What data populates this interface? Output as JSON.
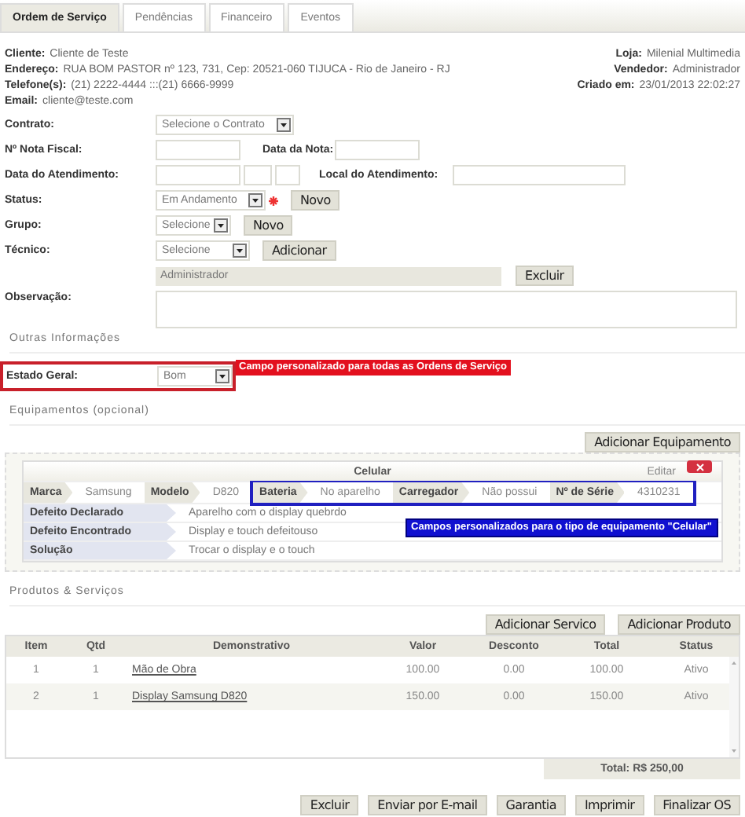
{
  "tabs": [
    {
      "label": "Ordem de Serviço",
      "selected": true
    },
    {
      "label": "Pendências",
      "selected": false
    },
    {
      "label": "Financeiro",
      "selected": false
    },
    {
      "label": "Eventos",
      "selected": false
    }
  ],
  "client_info": {
    "left": [
      {
        "label": "Cliente:",
        "value": "Cliente de Teste"
      },
      {
        "label": "Endereço:",
        "value": "RUA BOM PASTOR nº 123, 731, Cep: 20521-060 TIJUCA - Rio de Janeiro - RJ"
      },
      {
        "label": "Telefone(s):",
        "value": "(21) 2222-4444 :::(21) 6666-9999"
      },
      {
        "label": "Email:",
        "value": "cliente@teste.com"
      }
    ],
    "right": [
      {
        "label": "Loja:",
        "value": "Milenial Multimedia"
      },
      {
        "label": "Vendedor:",
        "value": "Administrador"
      },
      {
        "label": "Criado em:",
        "value": "23/01/2013 22:02:27"
      }
    ]
  },
  "form": {
    "contrato": {
      "label": "Contrato:",
      "placeholder": "Selecione o Contrato"
    },
    "nota_fiscal": {
      "label": "Nº Nota Fiscal:"
    },
    "data_nota": {
      "label": "Data da Nota:"
    },
    "data_atendimento": {
      "label": "Data do Atendimento:"
    },
    "local_atendimento": {
      "label": "Local do Atendimento:"
    },
    "status": {
      "label": "Status:",
      "value": "Em Andamento",
      "required": true,
      "button": "Novo"
    },
    "grupo": {
      "label": "Grupo:",
      "placeholder": "Selecione",
      "button": "Novo"
    },
    "tecnico": {
      "label": "Técnico:",
      "placeholder": "Selecione",
      "button": "Adicionar",
      "assigned": "Administrador",
      "remove_button": "Excluir"
    },
    "observacao": {
      "label": "Observação:"
    }
  },
  "outras_informacoes": {
    "title": "Outras Informações",
    "field": {
      "label": "Estado Geral:",
      "value": "Bom"
    },
    "callout": "Campo personalizado para todas as Ordens de Serviço"
  },
  "equipamentos": {
    "title": "Equipamentos (opcional)",
    "add_button": "Adicionar Equipamento",
    "card": {
      "title": "Celular",
      "edit": "Editar",
      "fields": [
        {
          "label": "Marca",
          "value": "Samsung",
          "custom": false
        },
        {
          "label": "Modelo",
          "value": "D820",
          "custom": false
        },
        {
          "label": "Bateria",
          "value": "No aparelho",
          "custom": true
        },
        {
          "label": "Carregador",
          "value": "Não possui",
          "custom": true
        },
        {
          "label": "Nº de Série",
          "value": "4310231",
          "custom": true
        }
      ],
      "rows": [
        {
          "label": "Defeito Declarado",
          "value": "Aparelho com o display quebrdo"
        },
        {
          "label": "Defeito Encontrado",
          "value": "Display e touch defeitouso"
        },
        {
          "label": "Solução",
          "value": "Trocar o display e o touch"
        }
      ],
      "callout": "Campos personalizados para o tipo de equipamento \"Celular\""
    }
  },
  "produtos": {
    "title": "Produtos & Serviços",
    "buttons": [
      "Adicionar Servico",
      "Adicionar Produto"
    ],
    "columns": [
      "Item",
      "Qtd",
      "Demonstrativo",
      "Valor",
      "Desconto",
      "Total",
      "Status"
    ],
    "rows": [
      [
        "1",
        "1",
        "Mão de Obra",
        "100.00",
        "0.00",
        "100.00",
        "Ativo"
      ],
      [
        "2",
        "1",
        "Display Samsung D820",
        "150.00",
        "0.00",
        "150.00",
        "Ativo"
      ]
    ],
    "total": "Total: R$ 250,00"
  },
  "actions": [
    "Excluir",
    "Enviar por E-mail",
    "Garantia",
    "Imprimir",
    "Finalizar OS"
  ]
}
